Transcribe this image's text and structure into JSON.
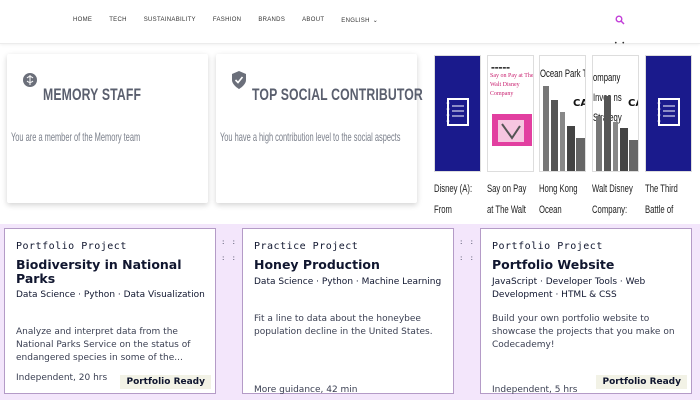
{
  "nav": {
    "items": [
      "HOME",
      "TECH",
      "SUSTAINABILITY",
      "FASHION",
      "BRANDS",
      "ABOUT",
      "ENGLISH"
    ],
    "search_icon": "search-icon",
    "accent": "#c23fd8"
  },
  "badges": [
    {
      "title": "MEMORY STAFF",
      "description": "You are a member of the Memory team",
      "icon": "brain-icon"
    },
    {
      "title": "TOP SOCIAL CONTRIBUTOR",
      "description": "You have a high contribution level to the social aspects",
      "icon": "shield-check-icon"
    }
  ],
  "books": [
    {
      "caption": "Disney (A): From",
      "cover_text": ""
    },
    {
      "caption": "Say on Pay at The Walt",
      "cover_text": "Say on Pay at The Walt Disney Company"
    },
    {
      "caption": "Hong Kong Ocean Park:",
      "cover_text": "Ocean Park Tal"
    },
    {
      "caption": "Walt Disney Company:",
      "cover_text": "ompany Inves ns Strategy"
    },
    {
      "caption": "The Third Battle of Bull Run: The",
      "cover_text": ""
    }
  ],
  "projects": [
    {
      "kind": "Portfolio Project",
      "title": "Biodiversity in National Parks",
      "tags": "Data Science · Python · Data Visualization",
      "description": "Analyze and interpret data from the National Parks Service on the status of endangered species in some of the...",
      "meta": "Independent, 20 hrs",
      "badge": "Portfolio Ready"
    },
    {
      "kind": "Practice Project",
      "title": "Honey Production",
      "tags": "Data Science · Python · Machine Learning",
      "description": "Fit a line to data about the honeybee population decline in the United States.",
      "meta": "More guidance, 42 min",
      "badge": ""
    },
    {
      "kind": "Portfolio Project",
      "title": "Portfolio Website",
      "tags": "JavaScript · Developer Tools · Web Development · HTML & CSS",
      "description": "Build your own portfolio website to showcase the projects that you make on Codecademy!",
      "meta": "Independent, 5 hrs",
      "badge": "Portfolio Ready"
    }
  ],
  "colors": {
    "lower_bg": "#f3e6fb",
    "card_border": "#b49bc7",
    "cover_blue": "#1a1a8c",
    "cover_pink": "#e23fa0"
  }
}
